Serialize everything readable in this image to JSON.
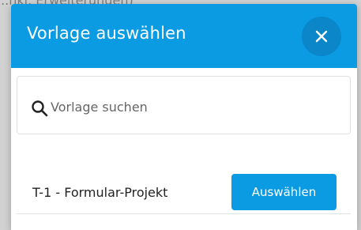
{
  "background": {
    "partial_text": "...nkl. Erweiterungen)"
  },
  "modal": {
    "title": "Vorlage auswählen",
    "close_icon": "close-icon",
    "search": {
      "placeholder": "Vorlage suchen",
      "value": "",
      "icon": "search-icon"
    },
    "templates": [
      {
        "name": "T-1 - Formular-Projekt",
        "button_label": "Auswählen"
      }
    ]
  },
  "colors": {
    "header": "#0a9be3",
    "close_button": "#0a86c9",
    "button": "#0a9be3"
  }
}
